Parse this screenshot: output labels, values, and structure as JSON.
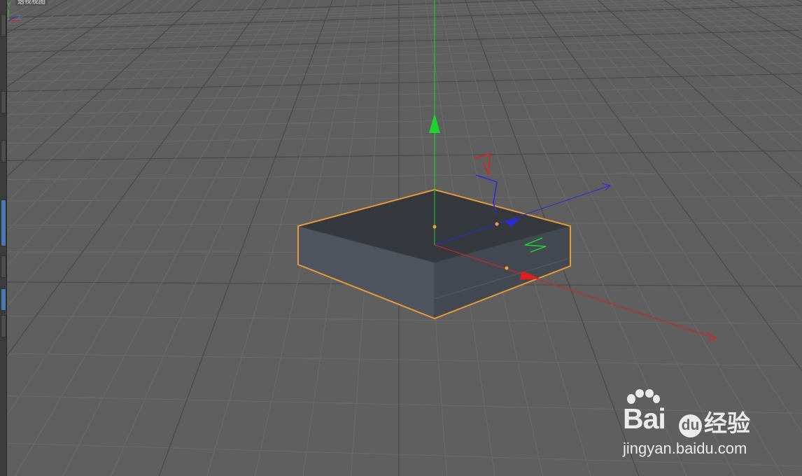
{
  "viewport": {
    "label": "透视视图",
    "colors": {
      "background": "#5f5f5f",
      "grid_minor": "#6c6c6c",
      "grid_major": "#4a4a4a",
      "object_top": "#35393e",
      "object_front": "#4f555e",
      "object_right": "#434950",
      "selection_outline": "#e69a3c",
      "axis_x": "#e02020",
      "axis_y": "#1fd32f",
      "axis_z": "#2a2ae0"
    },
    "object": {
      "name": "cube",
      "selected": true
    },
    "gizmo": {
      "axes": [
        "X",
        "Y",
        "Z"
      ]
    }
  },
  "corner_axes": {
    "y": "Y",
    "z": "Z"
  },
  "toolbar": {
    "buttons": [
      "btn-1",
      "btn-2",
      "btn-3",
      "btn-4",
      "btn-5",
      "btn-6",
      "btn-7"
    ],
    "active_index": 3
  },
  "watermark": {
    "bai": "Bai",
    "du": "du",
    "jingyan": "经验",
    "url": "jingyan.baidu.com"
  }
}
